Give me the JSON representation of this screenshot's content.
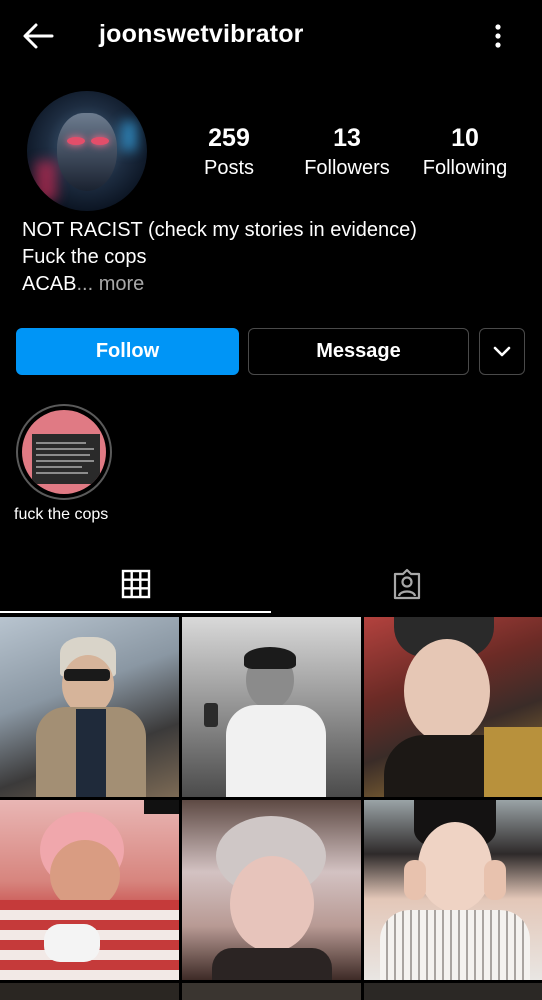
{
  "header": {
    "username": "joonswetvibrator",
    "back_icon": "back-arrow-icon",
    "more_icon": "vertical-ellipsis-icon"
  },
  "stats": {
    "posts_count": "259",
    "posts_label": "Posts",
    "followers_count": "13",
    "followers_label": "Followers",
    "following_count": "10",
    "following_label": "Following"
  },
  "bio": {
    "line1": "NOT RACIST (check my stories in evidence)",
    "line2": "Fuck the cops",
    "line3": "ACAB",
    "more": "... more"
  },
  "actions": {
    "follow_label": "Follow",
    "message_label": "Message",
    "dropdown_icon": "chevron-down-icon"
  },
  "highlights": [
    {
      "label": "fuck the cops"
    }
  ],
  "tabs": {
    "grid_icon": "grid-icon",
    "tagged_icon": "tagged-person-icon"
  },
  "colors": {
    "background": "#000000",
    "accent": "#0095f6",
    "muted_text": "#a8a8a8",
    "border": "#4a4a4a"
  }
}
